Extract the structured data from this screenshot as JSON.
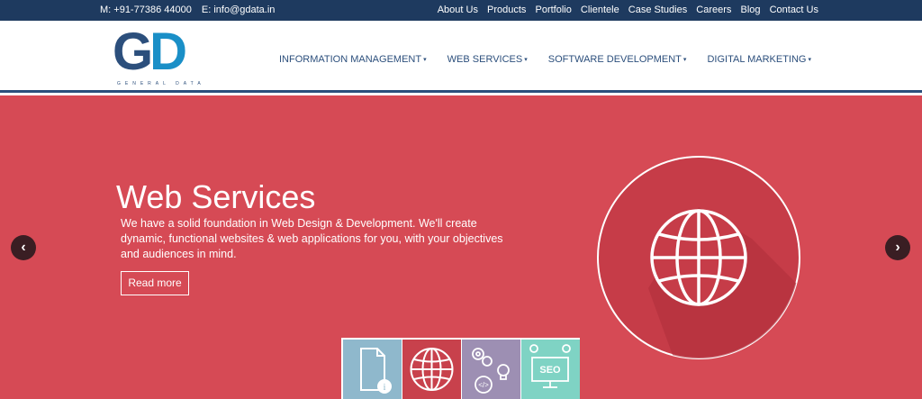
{
  "topbar": {
    "phone": "M: +91-77386 44000",
    "email": "E: info@gdata.in",
    "links": [
      "About Us",
      "Products",
      "Portfolio",
      "Clientele",
      "Case Studies",
      "Careers",
      "Blog",
      "Contact Us"
    ]
  },
  "logo": {
    "mark_g": "G",
    "mark_d": "D",
    "tagline": "GENERAL DATA"
  },
  "nav": {
    "items": [
      "INFORMATION MANAGEMENT",
      "WEB SERVICES",
      "SOFTWARE DEVELOPMENT",
      "DIGITAL MARKETING"
    ]
  },
  "hero": {
    "title": "Web Services",
    "description": "We have a solid foundation in Web Design & Development. We'll create dynamic, functional websites & web applications for you, with your objectives and audiences in mind.",
    "button": "Read more",
    "prev_arrow": "‹",
    "next_arrow": "›",
    "icon": "globe-icon"
  },
  "thumbnails": [
    {
      "icon": "document-info-icon",
      "color": "#8fb8cc",
      "text": ""
    },
    {
      "icon": "globe-icon",
      "color": "#c8414c",
      "text": ""
    },
    {
      "icon": "gears-code-icon",
      "color": "#9d8fb3",
      "text": ""
    },
    {
      "icon": "seo-monitor-icon",
      "color": "#7fd3c4",
      "text": "SEO"
    }
  ],
  "colors": {
    "topbar": "#1e3a5f",
    "brand": "#2c4f7c",
    "brand_accent": "#1a8fc7",
    "hero_bg": "#d64a55"
  }
}
